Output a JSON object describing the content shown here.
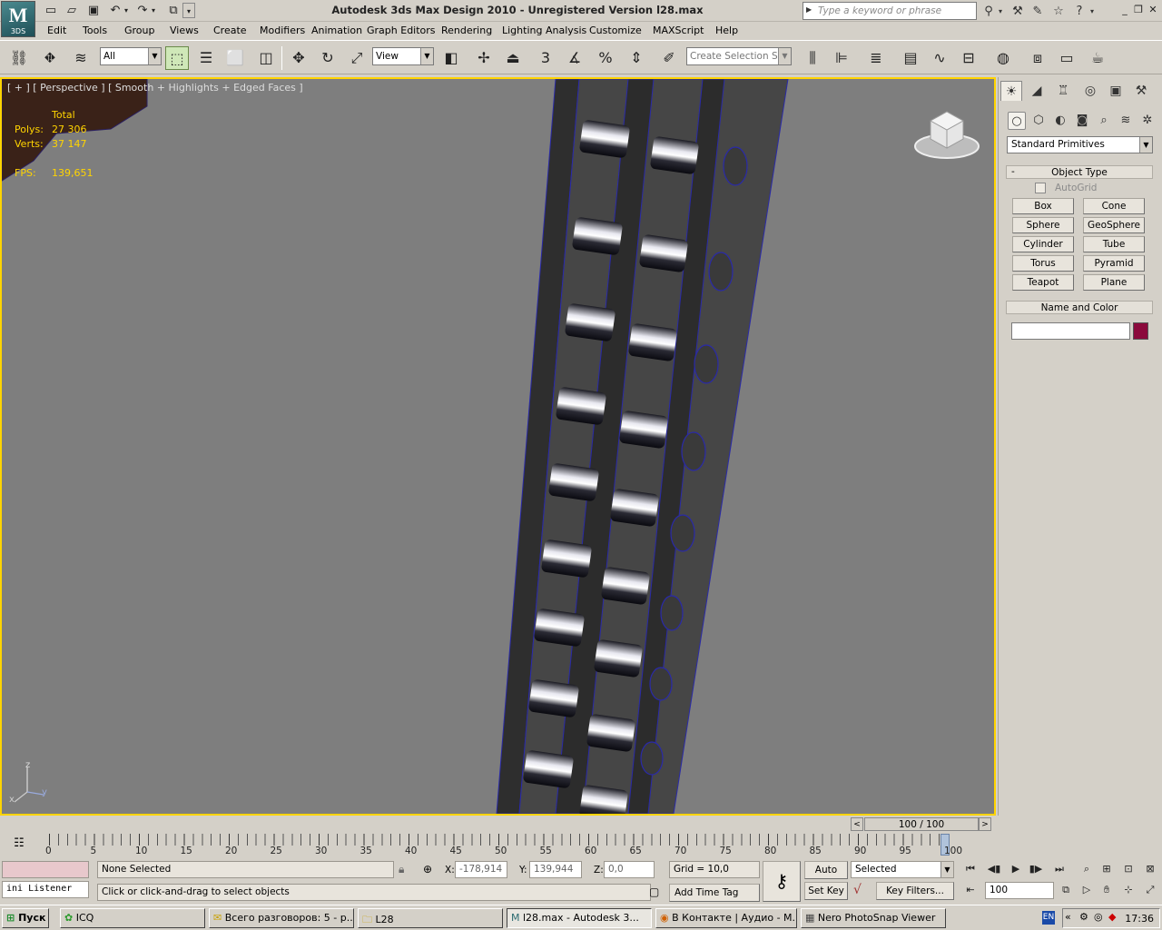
{
  "app": {
    "title": "Autodesk 3ds Max Design 2010  - Unregistered Version     l28.max",
    "logo_text": "M",
    "logo_sub": "3DS",
    "search_placeholder": "Type a keyword or phrase"
  },
  "menu": [
    "Edit",
    "Tools",
    "Group",
    "Views",
    "Create",
    "Modifiers",
    "Animation",
    "Graph Editors",
    "Rendering",
    "Lighting Analysis",
    "Customize",
    "MAXScript",
    "Help"
  ],
  "toolbar": {
    "selection_filter": "All",
    "ref_coord": "View",
    "named_selection_placeholder": "Create Selection Se",
    "snap_label": "3"
  },
  "viewport": {
    "label": "[ + ] [ Perspective ] [ Smooth + Highlights + Edged Faces ]",
    "stats_header": "Total",
    "polys_label": "Polys:",
    "polys_value": "27 306",
    "verts_label": "Verts:",
    "verts_value": "37 147",
    "fps_label": "FPS:",
    "fps_value": "139,651",
    "axis_z": "z",
    "axis_x": "x",
    "axis_y": "y"
  },
  "command_panel": {
    "primitive_type": "Standard Primitives",
    "object_type_title": "Object Type",
    "autogrid_label": "AutoGrid",
    "buttons": [
      "Box",
      "Cone",
      "Sphere",
      "GeoSphere",
      "Cylinder",
      "Tube",
      "Torus",
      "Pyramid",
      "Teapot",
      "Plane"
    ],
    "name_color_title": "Name and Color",
    "object_color": "#8b0a3c"
  },
  "timeline": {
    "frame_display": "100 / 100",
    "ticks": [
      "0",
      "5",
      "10",
      "15",
      "20",
      "25",
      "30",
      "35",
      "40",
      "45",
      "50",
      "55",
      "60",
      "65",
      "70",
      "75",
      "80",
      "85",
      "90",
      "95",
      "100"
    ]
  },
  "status": {
    "listener": "ini Listener",
    "selection": "None Selected",
    "prompt": "Click or click-and-drag to select objects",
    "x_label": "X:",
    "x_value": "-178,914",
    "y_label": "Y:",
    "y_value": "139,944",
    "z_label": "Z:",
    "z_value": "0,0",
    "grid": "Grid = 10,0",
    "add_time_tag": "Add Time Tag",
    "auto_key": "Auto Key",
    "set_key": "Set Key",
    "key_mode": "Selected",
    "key_filters": "Key Filters...",
    "current_frame": "100"
  },
  "taskbar": {
    "start": "Пуск",
    "tasks": [
      "ICQ",
      "Всего разговоров: 5 - р...",
      "L28",
      "l28.max - Autodesk 3...",
      "В Контакте | Аудио - М...",
      "Nero PhotoSnap Viewer"
    ],
    "lang": "EN",
    "clock": "17:36"
  }
}
